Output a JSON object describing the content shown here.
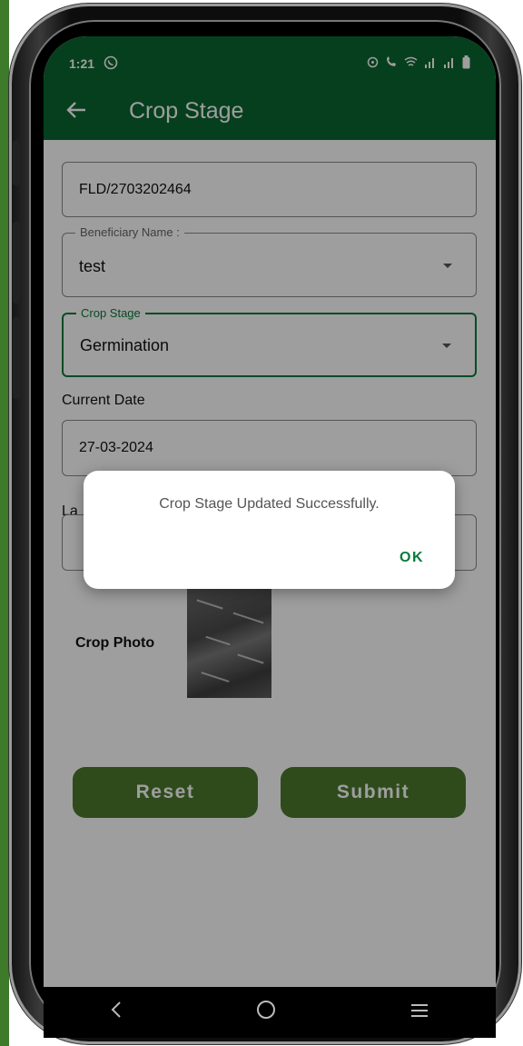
{
  "status_bar": {
    "time": "1:21"
  },
  "app_bar": {
    "title": "Crop Stage"
  },
  "form": {
    "field_id_value": "FLD/2703202464",
    "beneficiary": {
      "label": "Beneficiary Name :",
      "value": "test"
    },
    "crop_stage": {
      "label": "Crop Stage",
      "value": "Germination"
    },
    "current_date": {
      "label": "Current Date",
      "value": "27-03-2024"
    },
    "last_label_partial": "La",
    "crop_photo_label": "Crop Photo"
  },
  "buttons": {
    "reset": "Reset",
    "submit": "Submit"
  },
  "dialog": {
    "message": "Crop Stage Updated Successfully.",
    "ok": "OK"
  },
  "colors": {
    "primary": "#0a6630",
    "button": "#4d7a2e",
    "accent_text": "#0a7a3a"
  },
  "icons": [
    "whatsapp-icon",
    "back-arrow-icon",
    "dropdown-arrow-icon",
    "nav-back-icon",
    "nav-home-icon",
    "nav-recents-icon"
  ]
}
